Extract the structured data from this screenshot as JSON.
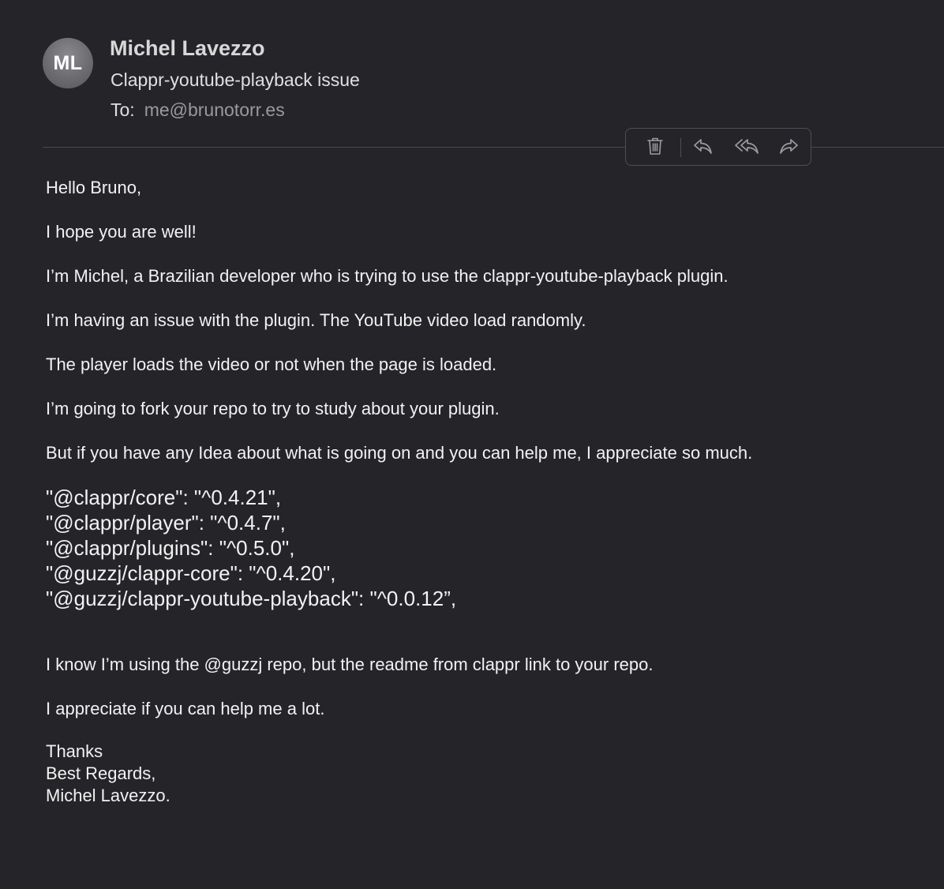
{
  "avatar_initials": "ML",
  "sender_name": "Michel Lavezzo",
  "subject": "Clappr-youtube-playback issue",
  "to_label": "To:",
  "to_address": "me@brunotorr.es",
  "toolbar": {
    "icons": [
      "trash-icon",
      "reply-icon",
      "reply-all-icon",
      "forward-icon"
    ]
  },
  "body": {
    "greeting": "Hello Bruno,",
    "p1": "I hope you are well!",
    "p2": "I’m Michel, a Brazilian developer who is trying to use the clappr-youtube-playback plugin.",
    "p3": "I’m having an issue with the plugin. The YouTube video load randomly.",
    "p4": "The player loads the video or not when the page is loaded.",
    "p5": "I’m going to fork your repo to try to study about your plugin.",
    "p6": "But if you have any Idea about what is going on and you can help me, I appreciate so much.",
    "code": [
      "\"@clappr/core\": \"^0.4.21\",",
      "\"@clappr/player\": \"^0.4.7\",",
      "\"@clappr/plugins\": \"^0.5.0\",",
      "\"@guzzj/clappr-core\": \"^0.4.20\",",
      "\"@guzzj/clappr-youtube-playback\": \"^0.0.12”,"
    ],
    "p7": "I know I’m using the @guzzj repo, but the readme from clappr link to your repo.",
    "p8": "I appreciate if you can help me a lot.",
    "signature": [
      "Thanks",
      "Best Regards,",
      "Michel Lavezzo."
    ]
  }
}
